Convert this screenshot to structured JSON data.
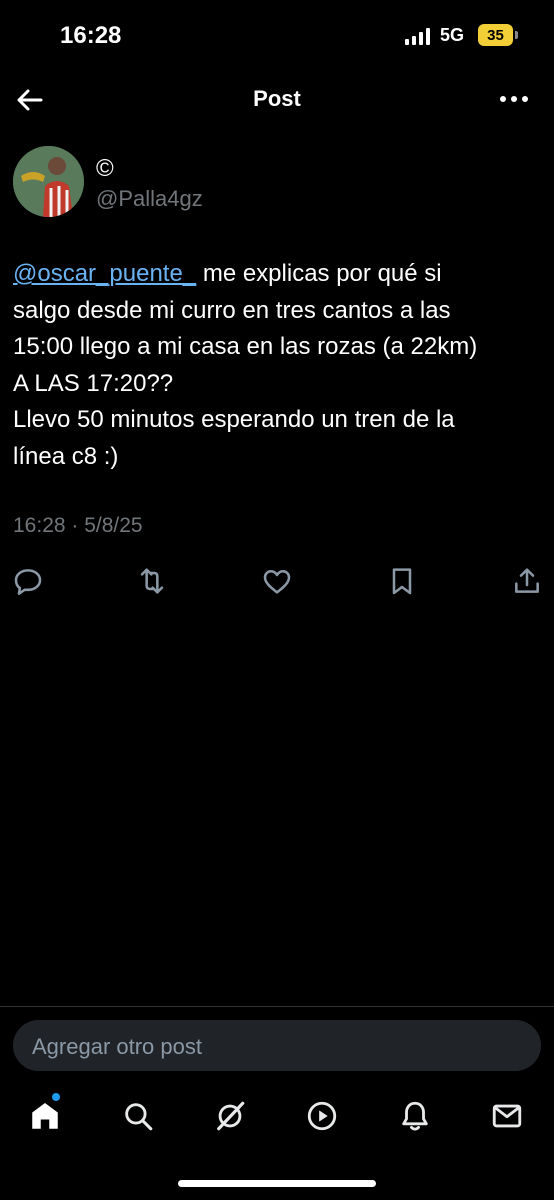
{
  "status_bar": {
    "time": "16:28",
    "network": "5G",
    "battery": "35"
  },
  "header": {
    "title": "Post"
  },
  "author": {
    "display_name": "©",
    "handle": "@Palla4gz"
  },
  "post": {
    "mention": "@oscar_puente_",
    "line1_rest": " me explicas por qué si",
    "line2": "salgo desde mi curro en tres cantos a las",
    "line3": "15:00 llego a mi casa en las rozas (a 22km)",
    "line4": "A LAS 17:20??",
    "line5": "Llevo 50 minutos esperando un tren de la",
    "line6": "línea c8 :)",
    "timestamp": "16:28 · 5/8/25"
  },
  "actions": [
    "reply-icon",
    "repost-icon",
    "like-icon",
    "bookmark-icon",
    "share-icon"
  ],
  "reply": {
    "placeholder": "Agregar otro post"
  },
  "bottom_nav": [
    "home-icon",
    "search-icon",
    "grok-icon",
    "video-icon",
    "notifications-icon",
    "messages-icon"
  ],
  "colors": {
    "background": "#000000",
    "accent": "#1d9bf0",
    "mention": "#6ab3f3",
    "muted": "#71767b",
    "battery": "#f2cf37"
  }
}
